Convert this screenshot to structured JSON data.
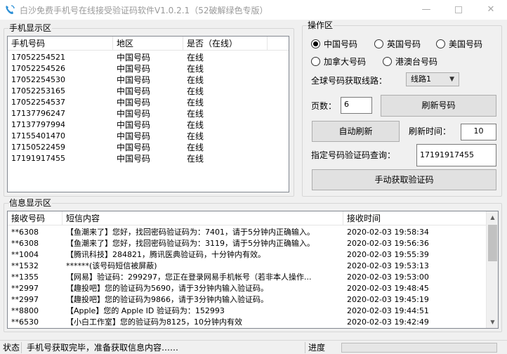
{
  "window": {
    "title": "白沙免费手机号在线接受验证码软件V1.0.2.1（52破解绿色专版）",
    "minimize_symbol": "—",
    "close_symbol": "✕"
  },
  "phone_panel": {
    "legend": "手机显示区",
    "columns": [
      "手机号码",
      "地区",
      "是否（在线）"
    ],
    "rows": [
      [
        "17052254521",
        "中国号码",
        "在线"
      ],
      [
        "17052254526",
        "中国号码",
        "在线"
      ],
      [
        "17052254530",
        "中国号码",
        "在线"
      ],
      [
        "17052253165",
        "中国号码",
        "在线"
      ],
      [
        "17052254537",
        "中国号码",
        "在线"
      ],
      [
        "17137796247",
        "中国号码",
        "在线"
      ],
      [
        "17137797994",
        "中国号码",
        "在线"
      ],
      [
        "17155401470",
        "中国号码",
        "在线"
      ],
      [
        "17150522459",
        "中国号码",
        "在线"
      ],
      [
        "17191917455",
        "中国号码",
        "在线"
      ]
    ]
  },
  "ops_panel": {
    "legend": "操作区",
    "radios": [
      {
        "label": "中国号码",
        "checked": true
      },
      {
        "label": "英国号码",
        "checked": false
      },
      {
        "label": "美国号码",
        "checked": false
      },
      {
        "label": "加拿大号码",
        "checked": false
      },
      {
        "label": "港澳台号码",
        "checked": false
      }
    ],
    "route_label": "全球号码获取线路：",
    "route_value": "线路1",
    "page_label": "页数：",
    "page_value": "6",
    "refresh_button": "刷新号码",
    "auto_refresh_button": "自动刷新",
    "refresh_time_label": "刷新时间：",
    "refresh_time_value": "10",
    "query_label": "指定号码验证码查询：",
    "query_value": "17191917455",
    "fetch_button": "手动获取验证码"
  },
  "info_panel": {
    "legend": "信息显示区",
    "columns": [
      "接收号码",
      "短信内容",
      "接收时间"
    ],
    "rows": [
      [
        "**6308",
        "【鱼潮来了】您好，找回密码验证码为：7401，请于5分钟内正确输入。",
        "2020-02-03 19:58:34"
      ],
      [
        "**6308",
        "【鱼潮来了】您好，找回密码验证码为：3119，请于5分钟内正确输入。",
        "2020-02-03 19:56:36"
      ],
      [
        "**1004",
        "【腾讯科技】284821，腾讯医典验证码，十分钟内有效。",
        "2020-02-03 19:55:39"
      ],
      [
        "**1532",
        "******(该号码短信被屏蔽)",
        "2020-02-03 19:53:13"
      ],
      [
        "**1355",
        "【网易】验证码：299297，您正在登录网易手机帐号（若非本人操作...",
        "2020-02-03 19:53:00"
      ],
      [
        "**2997",
        "【趣投吧】您的验证码为5690，请于3分钟内输入验证码。",
        "2020-02-03 19:48:45"
      ],
      [
        "**2997",
        "【趣投吧】您的验证码为9866，请于3分钟内输入验证码。",
        "2020-02-03 19:45:19"
      ],
      [
        "**8800",
        "【Apple】您的 Apple ID 验证码为：152993",
        "2020-02-03 19:44:51"
      ],
      [
        "**6530",
        "【小白工作室】您的验证码为8125，10分钟内有效",
        "2020-02-03 19:42:49"
      ]
    ]
  },
  "statusbar": {
    "status_label": "状态",
    "status_text": "手机号获取完毕，准备获取信息内容……",
    "progress_label": "进度",
    "progress_fraction": 0.0
  },
  "colors": {
    "progress_fill": "#06b025",
    "icon_blue": "#2b8fd6"
  }
}
